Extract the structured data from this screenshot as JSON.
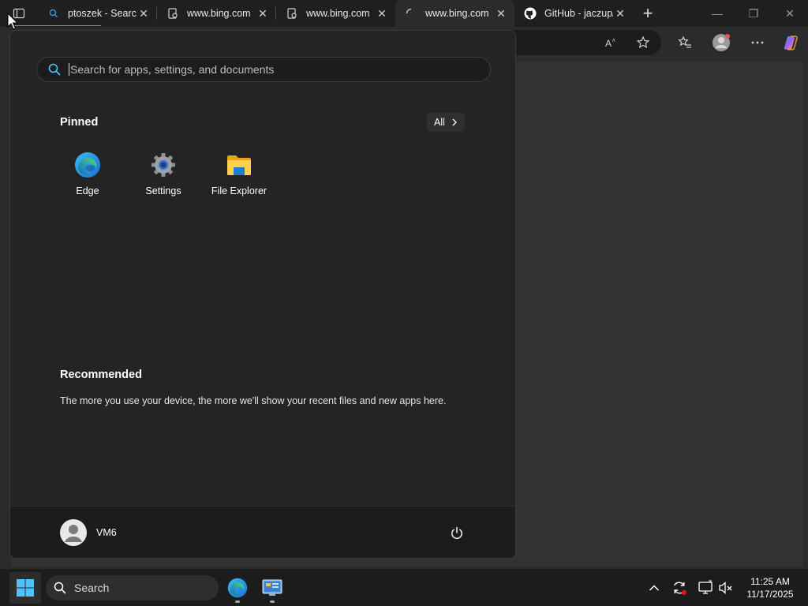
{
  "browser": {
    "tabs": [
      {
        "title": "ptoszek - Search",
        "icon": "bing-search-icon",
        "active": false
      },
      {
        "title": "www.bing.com",
        "icon": "page-icon",
        "active": false
      },
      {
        "title": "www.bing.com",
        "icon": "page-icon",
        "active": false
      },
      {
        "title": "www.bing.com",
        "icon": "loading-spinner-icon",
        "active": true
      },
      {
        "title": "GitHub - jaczup/",
        "icon": "github-icon",
        "active": false
      }
    ],
    "new_tab_label": "+",
    "window_controls": {
      "minimize": "—",
      "restore": "❐",
      "close": "✕"
    },
    "toolbar_icons": [
      "read-aloud-icon",
      "favorite-star-icon",
      "favorites-icon",
      "profile-icon",
      "more-icon",
      "copilot-icon"
    ]
  },
  "start_menu": {
    "search": {
      "placeholder": "Search for apps, settings, and documents",
      "value": ""
    },
    "pinned": {
      "title": "Pinned",
      "all_button": "All",
      "apps": [
        {
          "label": "Edge",
          "icon": "edge-icon"
        },
        {
          "label": "Settings",
          "icon": "settings-gear-icon"
        },
        {
          "label": "File Explorer",
          "icon": "folder-icon"
        }
      ]
    },
    "recommended": {
      "title": "Recommended",
      "empty_text": "The more you use your device, the more we'll show your recent files and new apps here."
    },
    "user": {
      "name": "VM6"
    }
  },
  "taskbar": {
    "search_label": "Search",
    "pinned_apps": [
      "edge-icon",
      "control-panel-icon"
    ],
    "tray_icons": [
      "show-hidden-icons-chevron",
      "update-icon",
      "network-icon",
      "volume-muted-icon"
    ],
    "clock": {
      "time": "11:25 AM",
      "date": "11/17/2025"
    }
  },
  "colors": {
    "accent_blue": "#0078d4",
    "panel_bg": "#242424",
    "taskbar_bg": "#1c1c1c"
  }
}
